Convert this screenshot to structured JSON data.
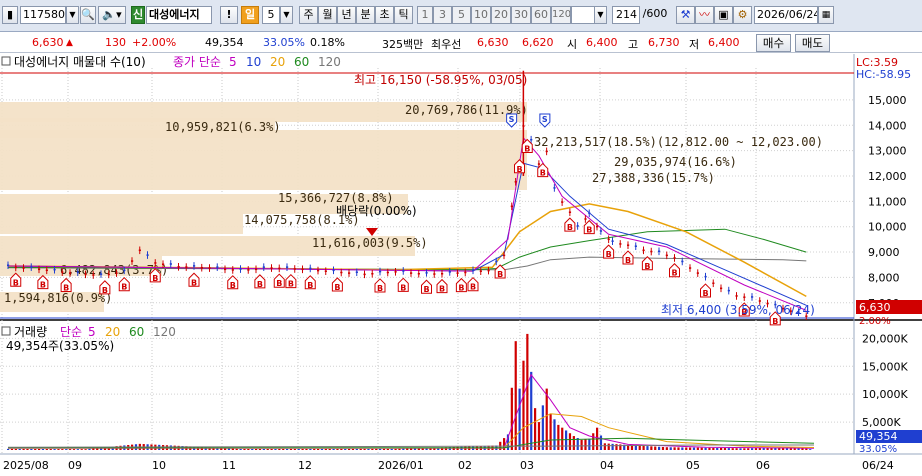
{
  "toolbar": {
    "code": "117580",
    "badge": "신",
    "stock_name": "대성에너지",
    "excl": "!",
    "period": "일",
    "period_count": "5",
    "tabs": [
      "주",
      "월",
      "년",
      "분",
      "초",
      "틱"
    ],
    "nums": [
      "1",
      "3",
      "5",
      "10",
      "20",
      "30",
      "60",
      "120"
    ],
    "count": "214",
    "count_total": "/600",
    "date": "2026/06/24"
  },
  "info": {
    "price": "6,630",
    "change": "130",
    "change_pct": "+2.00%",
    "volume": "49,354",
    "vol_ratio": "33.05%",
    "turnover": "0.18%",
    "amount": "325백만",
    "best_label": "최우선",
    "best_ask": "6,630",
    "best_bid": "6,620",
    "open_label": "시",
    "open": "6,400",
    "high_label": "고",
    "high": "6,730",
    "low_label": "저",
    "low": "6,400",
    "buy_btn": "매수",
    "sell_btn": "매도"
  },
  "chart_data": [
    {
      "type": "candlestick",
      "title": "대성에너지 매물대 수(10)",
      "legend": [
        {
          "name": "종가 단순",
          "periods": [
            "5",
            "10",
            "20",
            "60",
            "120"
          ]
        }
      ],
      "y_ticks": [
        "15,000",
        "14,000",
        "13,000",
        "12,000",
        "11,000",
        "10,000",
        "9,000",
        "8,000",
        "7,000"
      ],
      "x_ticks": [
        "2025/08",
        "09",
        "10",
        "11",
        "12",
        "2026/01",
        "02",
        "03",
        "04",
        "05",
        "06",
        "06/24"
      ],
      "right_labels": {
        "lc": "LC:3.59",
        "hc": "HC:-58.95",
        "price_box": "6,630",
        "pct_box": "2.00%"
      },
      "annotations": {
        "high": "최고 16,150 (-58.95%, 03/05)",
        "low": "최저 6,400 (3.59%, 06/24)",
        "dividend": "배당락(0.00%)"
      },
      "volume_profile": [
        {
          "price_from": 6400,
          "price_to": 7050,
          "volume": "1,594,816",
          "pct": "0.9%",
          "label": "1,594,816(0.9%)"
        },
        {
          "price_from": 7050,
          "price_to": 8400,
          "volume": "6,482,843",
          "pct": "3.7%",
          "label": "6,482,843(3.7%)"
        },
        {
          "price_from": 8400,
          "price_to": 8750,
          "volume": "11,616,003",
          "pct": "9.5%",
          "label": "11,616,003(9.5%)"
        },
        {
          "price_from": 8750,
          "price_to": 9500,
          "volume": "14,075,758",
          "pct": "8.1%",
          "label": "14,075,758(8.1%)"
        },
        {
          "price_from": 9500,
          "price_to": 10400,
          "volume": "15,366,727",
          "pct": "8.8%",
          "label": "15,366,727(8.8%)"
        },
        {
          "price_from": 10400,
          "price_to": 11400,
          "volume": "27,388,336",
          "pct": "15.7%",
          "label": "27,388,336(15.7%)"
        },
        {
          "price_from": 11400,
          "price_to": 12023,
          "volume": "29,035,974",
          "pct": "16.6%",
          "label": "29,035,974(16.6%)"
        },
        {
          "price_from": 12023,
          "price_to": 12812,
          "volume": "32,213,517",
          "pct": "18.5%",
          "label": "32,213,517(18.5%)(12,812.00 ~ 12,023.00)"
        },
        {
          "price_from": 12812,
          "price_to": 13800,
          "volume": "10,959,821",
          "pct": "6.3%",
          "label": "10,959,821(6.3%)"
        },
        {
          "price_from": 13800,
          "price_to": 14600,
          "volume": "20,769,786",
          "pct": "11.9%",
          "label": "20,769,786(11.9%)"
        }
      ],
      "price_series": [
        [
          0,
          8450
        ],
        [
          8,
          8350
        ],
        [
          16,
          8200
        ],
        [
          24,
          8100
        ],
        [
          30,
          8250
        ],
        [
          34,
          9100
        ],
        [
          38,
          8600
        ],
        [
          44,
          8450
        ],
        [
          52,
          8400
        ],
        [
          60,
          8300
        ],
        [
          68,
          8400
        ],
        [
          76,
          8350
        ],
        [
          84,
          8250
        ],
        [
          92,
          8150
        ],
        [
          100,
          8250
        ],
        [
          108,
          8150
        ],
        [
          116,
          8200
        ],
        [
          124,
          8300
        ],
        [
          128,
          8900
        ],
        [
          131,
          11800
        ],
        [
          133,
          14000
        ],
        [
          135,
          13400
        ],
        [
          137,
          12500
        ],
        [
          139,
          13000
        ],
        [
          141,
          11500
        ],
        [
          143,
          11000
        ],
        [
          145,
          10600
        ],
        [
          147,
          10000
        ],
        [
          150,
          10500
        ],
        [
          153,
          9800
        ],
        [
          156,
          9400
        ],
        [
          160,
          9300
        ],
        [
          164,
          9100
        ],
        [
          168,
          9000
        ],
        [
          172,
          8800
        ],
        [
          176,
          8400
        ],
        [
          180,
          8000
        ],
        [
          184,
          7600
        ],
        [
          188,
          7300
        ],
        [
          192,
          7200
        ],
        [
          196,
          7000
        ],
        [
          200,
          6800
        ],
        [
          204,
          6600
        ],
        [
          208,
          6400
        ]
      ],
      "signals_buy": [
        2,
        9,
        15,
        25,
        30,
        38,
        48,
        58,
        65,
        70,
        73,
        78,
        85,
        96,
        102,
        108,
        112,
        117,
        120,
        127,
        132,
        134,
        138,
        145,
        150,
        155,
        160,
        165,
        172,
        180,
        190,
        198
      ],
      "signals_sell": [
        131,
        137
      ]
    },
    {
      "type": "bar",
      "title": "거래량",
      "legend": [
        {
          "name": "단순",
          "periods": [
            "5",
            "20",
            "60",
            "120"
          ]
        }
      ],
      "readout": "49,354주(33.05%)",
      "y_ticks": [
        "20,000K",
        "15,000K",
        "10,000K",
        "5,000K"
      ],
      "right_labels": {
        "value": "49,354",
        "pct": "33.05%"
      },
      "values_k": [
        [
          0,
          200
        ],
        [
          20,
          150
        ],
        [
          34,
          1100
        ],
        [
          60,
          180
        ],
        [
          100,
          200
        ],
        [
          126,
          800
        ],
        [
          129,
          2800
        ],
        [
          131,
          19500
        ],
        [
          132,
          11000
        ],
        [
          133,
          16000
        ],
        [
          134,
          20800
        ],
        [
          135,
          14000
        ],
        [
          136,
          7500
        ],
        [
          137,
          5000
        ],
        [
          139,
          11000
        ],
        [
          140,
          6500
        ],
        [
          142,
          4500
        ],
        [
          144,
          3500
        ],
        [
          146,
          2500
        ],
        [
          148,
          1800
        ],
        [
          150,
          2000
        ],
        [
          152,
          4000
        ],
        [
          154,
          1200
        ],
        [
          160,
          900
        ],
        [
          170,
          500
        ],
        [
          180,
          400
        ],
        [
          190,
          300
        ],
        [
          200,
          450
        ],
        [
          206,
          250
        ],
        [
          208,
          49
        ]
      ]
    }
  ]
}
